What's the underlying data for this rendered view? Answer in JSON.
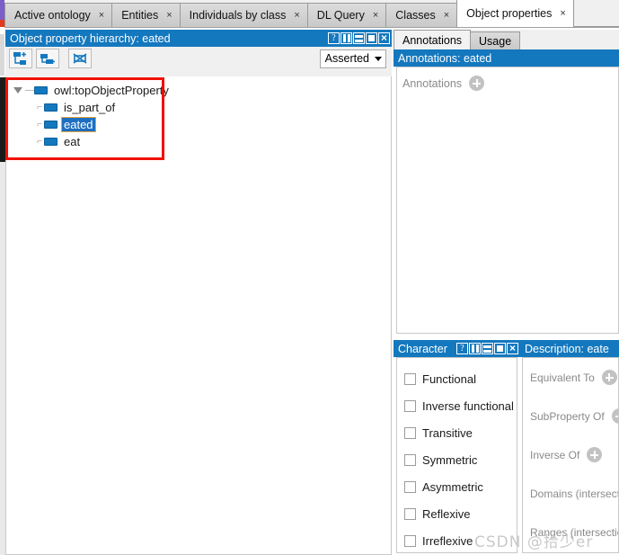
{
  "window": {
    "tabs": [
      {
        "label": "Active ontology",
        "close": "×",
        "active": false
      },
      {
        "label": "Entities",
        "close": "×",
        "active": false
      },
      {
        "label": "Individuals by class",
        "close": "×",
        "active": false
      },
      {
        "label": "DL Query",
        "close": "×",
        "active": false
      },
      {
        "label": "Classes",
        "close": "×",
        "active": false
      },
      {
        "label": "Object properties",
        "close": "×",
        "active": true
      }
    ]
  },
  "hierarchy_panel": {
    "title": "Object property hierarchy: eated",
    "window_buttons": [
      "help-icon",
      "vsplit-icon",
      "hsplit-icon",
      "maximize-icon",
      "close-icon"
    ],
    "toolbar": {
      "add_sub_property": "add-sub-property-icon",
      "add_sibling_property": "add-sibling-property-icon",
      "delete_property": "delete-property-icon",
      "view_mode": "Asserted"
    },
    "tree": [
      {
        "label": "owl:topObjectProperty",
        "level": 0,
        "expanded": true,
        "selected": false
      },
      {
        "label": "is_part_of",
        "level": 1,
        "expanded": false,
        "selected": false
      },
      {
        "label": "eated",
        "level": 1,
        "expanded": false,
        "selected": true
      },
      {
        "label": "eat",
        "level": 1,
        "expanded": false,
        "selected": false
      }
    ]
  },
  "annotations_panel": {
    "tabs": [
      {
        "label": "Annotations",
        "active": true
      },
      {
        "label": "Usage",
        "active": false
      }
    ],
    "title": "Annotations: eated",
    "add_row_label": "Annotations",
    "add_button": "add-annotation-icon"
  },
  "characteristics_panel": {
    "title": "Character",
    "items": [
      {
        "label": "Functional",
        "checked": false
      },
      {
        "label": "Inverse functional",
        "checked": false
      },
      {
        "label": "Transitive",
        "checked": false
      },
      {
        "label": "Symmetric",
        "checked": false
      },
      {
        "label": "Asymmetric",
        "checked": false
      },
      {
        "label": "Reflexive",
        "checked": false
      },
      {
        "label": "Irreflexive",
        "checked": false
      }
    ]
  },
  "description_panel": {
    "title": "Description: eate",
    "items": [
      {
        "label": "Equivalent To",
        "add_button": "add-equivalent-to-icon"
      },
      {
        "label": "SubProperty Of",
        "add_button": "add-subproperty-of-icon"
      },
      {
        "label": "Inverse Of",
        "add_button": "add-inverse-of-icon"
      },
      {
        "label": "Domains (intersection",
        "add_button": "add-domain-icon"
      },
      {
        "label": "Ranges (intersection",
        "add_button": "add-range-icon"
      }
    ]
  },
  "watermark": {
    "text": "CSDN @拾少er"
  },
  "colors": {
    "panel_header": "#1478be",
    "selection": "#1e6fc0",
    "selection_border": "#e8a33d",
    "annotation_box": "#f01000",
    "property_icon": "#1478be"
  }
}
